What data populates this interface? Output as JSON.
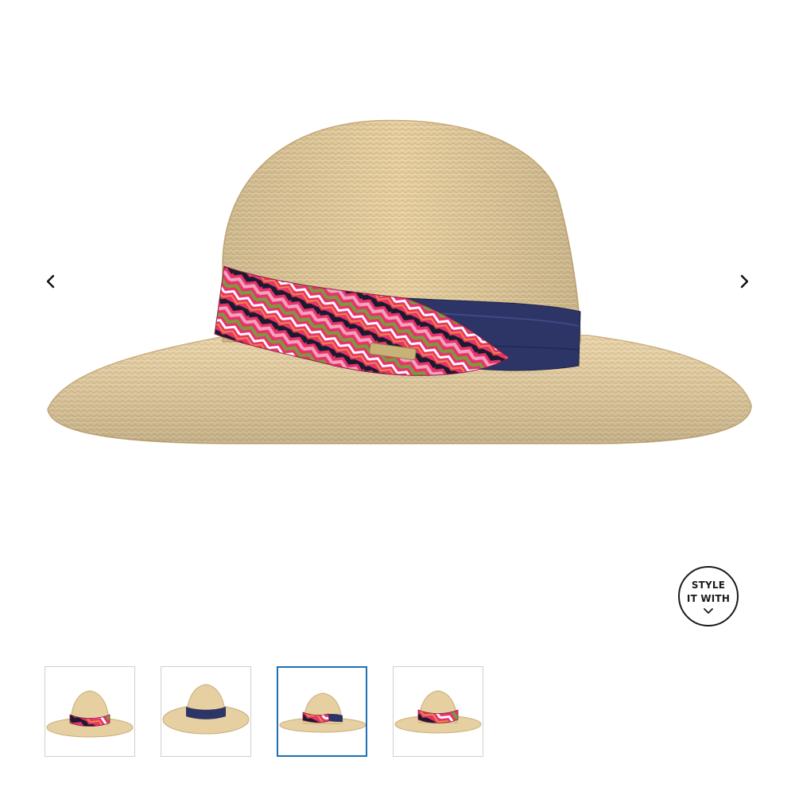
{
  "product_gallery": {
    "main_image": {
      "subject": "straw-sun-hat",
      "colors": {
        "straw": "#e8d2a6",
        "straw_shadow": "#cdb07a",
        "band_navy": "#2c3566",
        "band_pink": "#e8326e"
      }
    },
    "prev_arrow_icon": "chevron-left-icon",
    "next_arrow_icon": "chevron-right-icon",
    "style_it_with": {
      "line1": "STYLE",
      "line2": "IT WITH",
      "icon": "chevron-down-icon"
    },
    "thumbnails": [
      {
        "view": "front-band",
        "active": false
      },
      {
        "view": "back-navy-band",
        "active": false
      },
      {
        "view": "side-band",
        "active": true
      },
      {
        "view": "three-quarter-band",
        "active": false
      }
    ],
    "active_border_color": "#1f6fb2"
  }
}
